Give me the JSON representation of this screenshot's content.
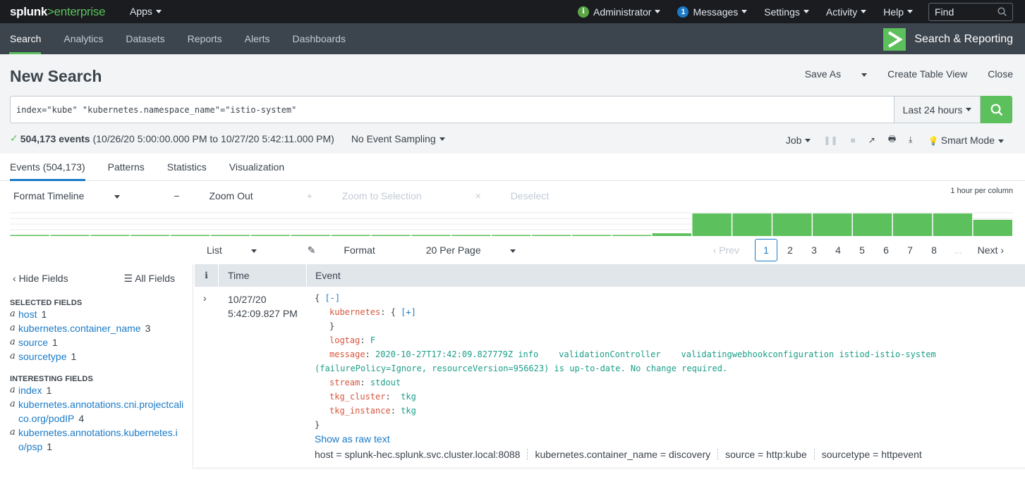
{
  "topbar": {
    "logo_main": "splunk",
    "logo_gt": ">",
    "logo_product": "enterprise",
    "apps_label": "Apps",
    "admin_label": "Administrator",
    "admin_badge": "i",
    "messages_count": "1",
    "messages_label": "Messages",
    "settings_label": "Settings",
    "activity_label": "Activity",
    "help_label": "Help",
    "find_placeholder": "Find"
  },
  "nav": {
    "items": [
      {
        "label": "Search",
        "active": true
      },
      {
        "label": "Analytics"
      },
      {
        "label": "Datasets"
      },
      {
        "label": "Reports"
      },
      {
        "label": "Alerts"
      },
      {
        "label": "Dashboards"
      }
    ],
    "app_title": "Search & Reporting"
  },
  "header": {
    "title": "New Search",
    "save_as": "Save As",
    "create_table_view": "Create Table View",
    "close": "Close"
  },
  "search": {
    "query": "index=\"kube\" \"kubernetes.namespace_name\"=\"istio-system\"",
    "time_range": "Last 24 hours"
  },
  "status": {
    "event_count": "504,173 events",
    "range": "(10/26/20 5:00:00.000 PM to 10/27/20 5:42:11.000 PM)",
    "sampling": "No Event Sampling",
    "job_label": "Job",
    "mode": "Smart Mode"
  },
  "tabs": [
    {
      "label": "Events (504,173)",
      "active": true
    },
    {
      "label": "Patterns"
    },
    {
      "label": "Statistics"
    },
    {
      "label": "Visualization"
    }
  ],
  "timeline": {
    "format_label": "Format Timeline",
    "zoom_out": "Zoom Out",
    "zoom_selection": "Zoom to Selection",
    "deselect": "Deselect",
    "scale_label": "1 hour per column",
    "bar_color": "#5cc05c",
    "relative_counts": [
      0.02,
      0.02,
      0.02,
      0.02,
      0.02,
      0.02,
      0.02,
      0.02,
      0.02,
      0.02,
      0.02,
      0.02,
      0.02,
      0.02,
      0.02,
      0.02,
      0.12,
      1,
      1,
      1,
      1,
      1,
      1,
      1,
      0.72
    ]
  },
  "results_toolbar": {
    "list_label": "List",
    "format_label": "Format",
    "per_page_label": "20 Per Page",
    "prev_label": "Prev",
    "pages": [
      "1",
      "2",
      "3",
      "4",
      "5",
      "6",
      "7",
      "8"
    ],
    "current_page": "1",
    "ellipsis": "...",
    "next_label": "Next"
  },
  "sidebar": {
    "hide_fields": "Hide Fields",
    "all_fields": "All Fields",
    "selected_heading": "SELECTED FIELDS",
    "selected_fields": [
      {
        "type": "a",
        "name": "host",
        "count": "1"
      },
      {
        "type": "a",
        "name": "kubernetes.container_name",
        "count": "3"
      },
      {
        "type": "a",
        "name": "source",
        "count": "1"
      },
      {
        "type": "a",
        "name": "sourcetype",
        "count": "1"
      }
    ],
    "interesting_heading": "INTERESTING FIELDS",
    "interesting_fields": [
      {
        "type": "a",
        "name": "index",
        "count": "1"
      },
      {
        "type": "a",
        "name": "kubernetes.annotations.cni.projectcalico.org/podIP",
        "count": "4"
      },
      {
        "type": "a",
        "name": "kubernetes.annotations.kubernetes.io/psp",
        "count": "1"
      }
    ]
  },
  "table": {
    "col_info": "i",
    "col_time": "Time",
    "col_event": "Event",
    "rows": [
      {
        "date": "10/27/20",
        "time": "5:42:09.827 PM",
        "collapse_link": "[-]",
        "expand_link": "[+]",
        "fields": {
          "kubernetes_key": "kubernetes",
          "logtag_key": "logtag",
          "logtag_val": "F",
          "message_key": "message",
          "message_val_line1": "2020-10-27T17:42:09.827779Z info    validationController    validatingwebhookconfiguration istiod-istio-system",
          "message_val_line2": "(failurePolicy=Ignore, resourceVersion=956623) is up-to-date. No change required.",
          "stream_key": "stream",
          "stream_val": "stdout",
          "tkg_cluster_key": "tkg_cluster",
          "tkg_cluster_val": " tkg",
          "tkg_instance_key": "tkg_instance",
          "tkg_instance_val": "tkg"
        },
        "raw_link": "Show as raw text",
        "meta": [
          {
            "key": "host",
            "value": "splunk-hec.splunk.svc.cluster.local:8088"
          },
          {
            "key": "kubernetes.container_name",
            "value": "discovery"
          },
          {
            "key": "source",
            "value": "http:kube"
          },
          {
            "key": "sourcetype",
            "value": "httpevent"
          }
        ]
      }
    ]
  }
}
